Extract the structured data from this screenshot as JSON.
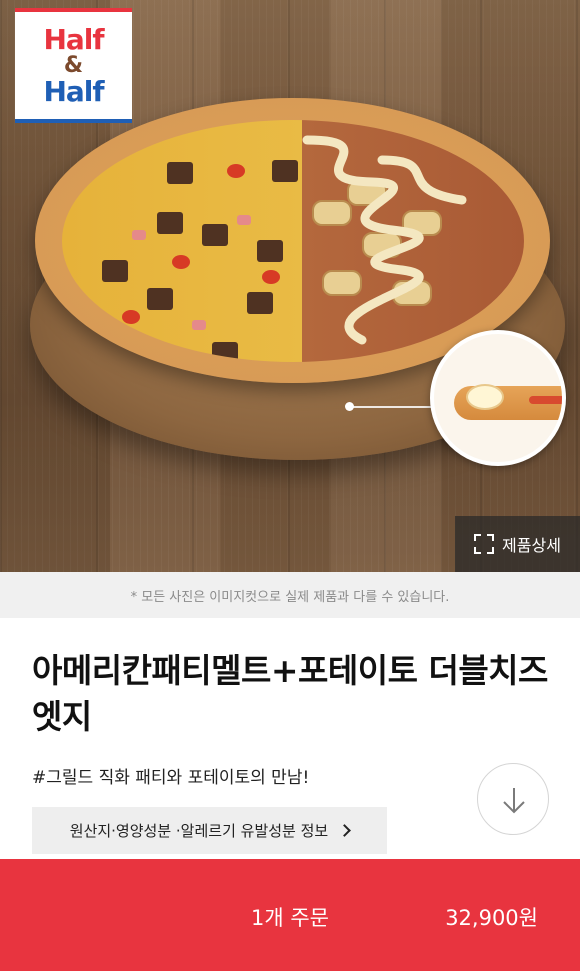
{
  "logo": {
    "line1": "Half",
    "line2": "&",
    "line3": "Half"
  },
  "hero": {
    "detail_button_label": "제품상세"
  },
  "disclaimer": "* 모든 사진은 이미지컷으로 실제 제품과 다를 수 있습니다.",
  "product": {
    "title": "아메리칸패티멜트+포테이토 더블치즈엣지",
    "subtitle": "#그릴드 직화 패티와 포테이토의 만남!",
    "info_button_label": "원산지·영양성분 ·알레르기 유발성분 정보"
  },
  "order": {
    "label": "1개 주문",
    "price": "32,900원"
  },
  "colors": {
    "accent": "#e8343f",
    "logo_blue": "#1f5fb5"
  },
  "icons": {
    "detail": "expand-frame-icon",
    "info_arrow": "chevron-right-icon",
    "scroll": "arrow-down-icon"
  }
}
